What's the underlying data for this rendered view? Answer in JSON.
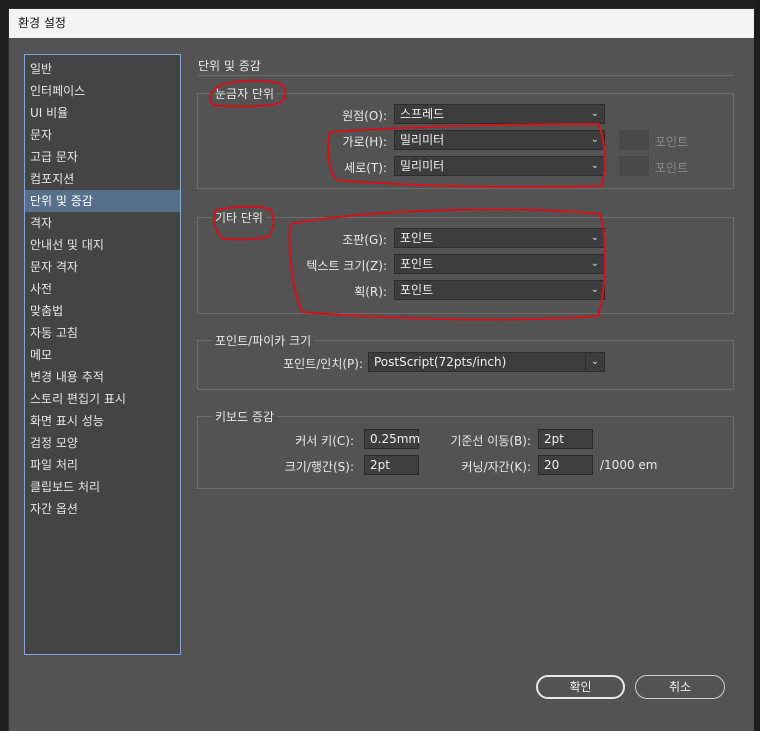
{
  "window": {
    "title": "환경 설정"
  },
  "sidebar": {
    "items": [
      {
        "label": "일반"
      },
      {
        "label": "인터페이스"
      },
      {
        "label": "UI 비율"
      },
      {
        "label": "문자"
      },
      {
        "label": "고급 문자"
      },
      {
        "label": "컴포지션"
      },
      {
        "label": "단위 및 증감",
        "selected": true
      },
      {
        "label": "격자"
      },
      {
        "label": "안내선 및 대지"
      },
      {
        "label": "문자 격자"
      },
      {
        "label": "사전"
      },
      {
        "label": "맞춤법"
      },
      {
        "label": "자동 고침"
      },
      {
        "label": "메모"
      },
      {
        "label": "변경 내용 추적"
      },
      {
        "label": "스토리 편집기 표시"
      },
      {
        "label": "화면 표시 성능"
      },
      {
        "label": "검정 모양"
      },
      {
        "label": "파일 처리"
      },
      {
        "label": "클립보드 처리"
      },
      {
        "label": "자간 옵션"
      }
    ]
  },
  "main": {
    "title": "단위 및 증감",
    "ruler_units": {
      "title": "눈금자 단위",
      "origin": {
        "label": "원점(O):",
        "value": "스프레드"
      },
      "horizontal": {
        "label": "가로(H):",
        "value": "밀리미터",
        "suffix": "포인트"
      },
      "vertical": {
        "label": "세로(T):",
        "value": "밀리미터",
        "suffix": "포인트"
      }
    },
    "other_units": {
      "title": "기타 단위",
      "composition": {
        "label": "조판(G):",
        "value": "포인트"
      },
      "text_size": {
        "label": "텍스트 크기(Z):",
        "value": "포인트"
      },
      "stroke": {
        "label": "획(R):",
        "value": "포인트"
      }
    },
    "pica_size": {
      "title": "포인트/파이카 크기",
      "points_per_inch": {
        "label": "포인트/인치(P):",
        "value": "PostScript(72pts/inch)"
      }
    },
    "keyboard": {
      "title": "키보드 증감",
      "cursor_key": {
        "label": "커서 키(C):",
        "value": "0.25mm"
      },
      "baseline_shift": {
        "label": "기준선 이동(B):",
        "value": "2pt"
      },
      "size_leading": {
        "label": "크기/행간(S):",
        "value": "2pt"
      },
      "kerning": {
        "label": "커닝/자간(K):",
        "value": "20",
        "unit": "/1000 em"
      }
    }
  },
  "buttons": {
    "ok": "확인",
    "cancel": "취소"
  },
  "annotation_color": "#d4141c"
}
